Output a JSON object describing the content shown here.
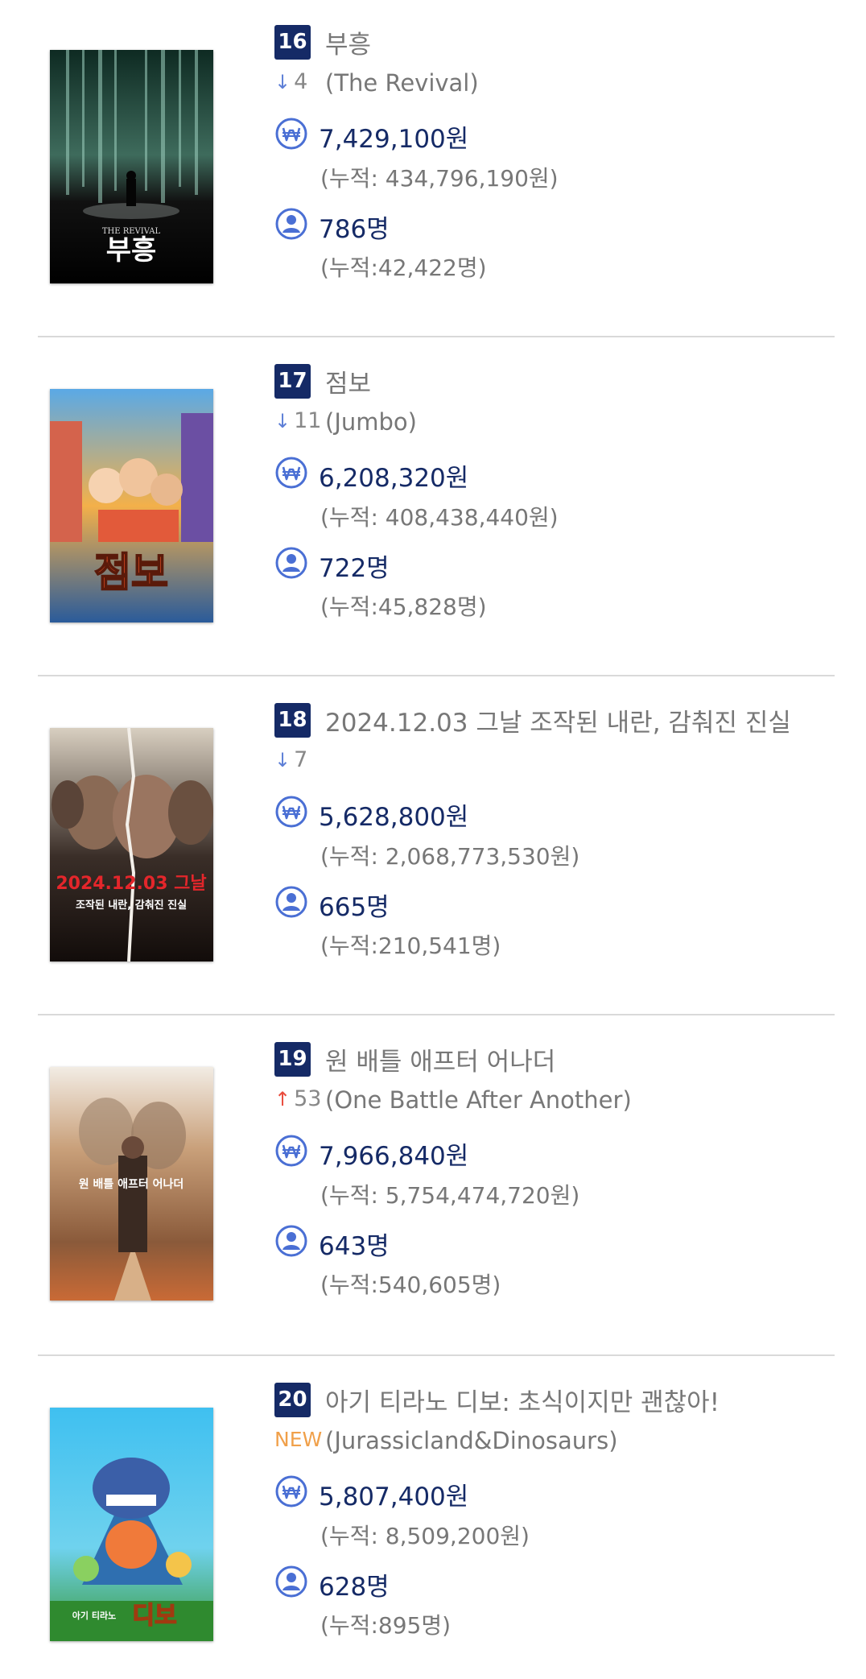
{
  "items": [
    {
      "rank": "16",
      "title": "부흥",
      "change_dir": "down",
      "change_text": "4",
      "eng_title": "(The Revival)",
      "sales": "7,429,100원",
      "sales_acc": "(누적: 434,796,190원)",
      "audience": "786명",
      "audience_acc": "(누적:42,422명)",
      "poster": {
        "title_text": "부흥",
        "sub_text": "THE REVIVAL"
      }
    },
    {
      "rank": "17",
      "title": "점보",
      "change_dir": "down",
      "change_text": "11",
      "eng_title": "(Jumbo)",
      "sales": "6,208,320원",
      "sales_acc": "(누적: 408,438,440원)",
      "audience": "722명",
      "audience_acc": "(누적:45,828명)",
      "poster": {
        "title_text": "점보",
        "sub_text": ""
      }
    },
    {
      "rank": "18",
      "title": "2024.12.03 그날 조작된 내란, 감춰진 진실",
      "change_dir": "down",
      "change_text": "7",
      "eng_title": "",
      "sales": "5,628,800원",
      "sales_acc": "(누적: 2,068,773,530원)",
      "audience": "665명",
      "audience_acc": "(누적:210,541명)",
      "poster": {
        "title_text": "2024.12.03 그날",
        "sub_text": "조작된 내란, 감춰진 진실"
      }
    },
    {
      "rank": "19",
      "title": "원 배틀 애프터 어나더",
      "change_dir": "up",
      "change_text": "53",
      "eng_title": "(One Battle After Another)",
      "sales": "7,966,840원",
      "sales_acc": "(누적: 5,754,474,720원)",
      "audience": "643명",
      "audience_acc": "(누적:540,605명)",
      "poster": {
        "title_text": "원 배틀 애프터 어나더",
        "sub_text": ""
      }
    },
    {
      "rank": "20",
      "title": "아기 티라노 디보: 초식이지만 괜찮아!",
      "change_dir": "new",
      "change_text": "NEW",
      "eng_title": "(Jurassicland&Dinosaurs)",
      "sales": "5,807,400원",
      "sales_acc": "(누적: 8,509,200원)",
      "audience": "628명",
      "audience_acc": "(누적:895명)",
      "poster": {
        "title_text": "디보",
        "sub_text": "아기 티라노"
      }
    }
  ],
  "icons": {
    "won": "won-currency-icon",
    "person": "person-icon",
    "down": "arrow-down-icon",
    "up": "arrow-up-icon"
  },
  "colors": {
    "navy": "#152a66",
    "gray_text": "#777777",
    "down_arrow": "#5d7fd6",
    "up_arrow": "#e94b3c",
    "new_badge": "#f0a04a"
  }
}
